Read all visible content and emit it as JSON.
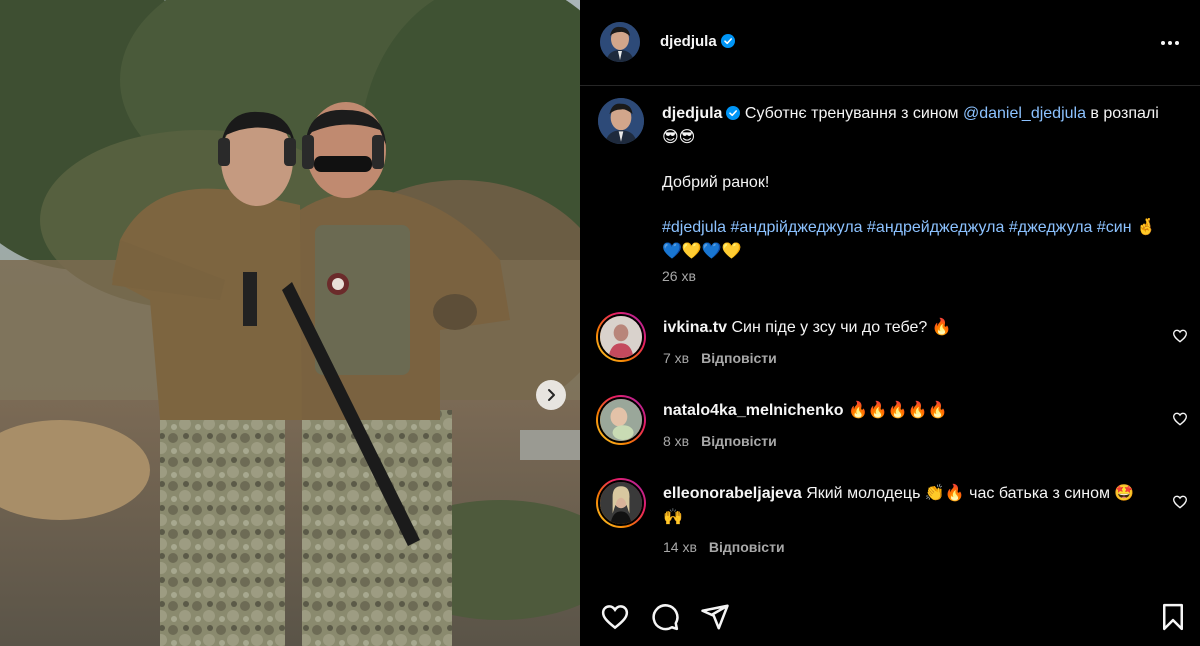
{
  "post": {
    "username": "djedjula",
    "verified": true
  },
  "caption": {
    "username": "djedjula",
    "text_before_mention": "Суботнє тренування з сином ",
    "mention": "@daniel_djedjula",
    "text_after_mention": " в розпалі 😎😎",
    "line2": "Добрий ранок!",
    "hashtags": [
      "#djedjula",
      "#андрійджеджула",
      "#андрейджеджула",
      "#джеджула",
      "#син"
    ],
    "hashtag_suffix": "🤞💙💛💙💛",
    "time": "26 хв"
  },
  "comments": [
    {
      "username": "ivkina.tv",
      "text": "Син піде у зсу чи до тебе? 🔥",
      "time": "7 хв",
      "reply": "Відповісти"
    },
    {
      "username": "natalo4ka_melnichenko",
      "text": "🔥🔥🔥🔥🔥",
      "time": "8 хв",
      "reply": "Відповісти"
    },
    {
      "username": "elleonorabeljajeva",
      "text": "Який молодець 👏🔥 час батька з сином 🤩🙌",
      "time": "14 хв",
      "reply": "Відповісти"
    }
  ],
  "icons": {
    "verified": "verified-badge-icon",
    "more": "more-options-icon",
    "next": "chevron-right-icon",
    "like": "heart-icon",
    "comment": "comment-icon",
    "share": "share-icon",
    "save": "bookmark-icon"
  },
  "colors": {
    "background": "#000000",
    "text": "#f5f5f5",
    "secondary_text": "#a8a8a8",
    "link": "#8cc2ff",
    "verified": "#0095f6"
  }
}
